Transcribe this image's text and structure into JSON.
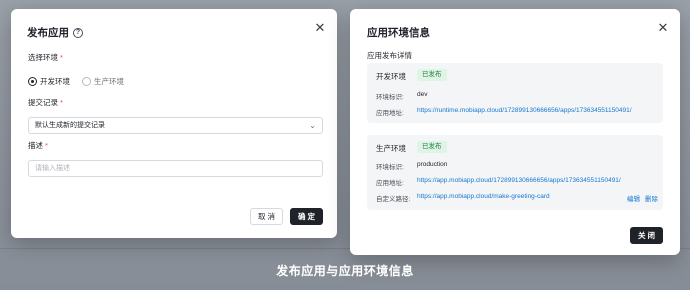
{
  "publish_dialog": {
    "title": "发布应用",
    "help_glyph": "?",
    "close_glyph": "✕",
    "env_label": "选择环境",
    "env_options": [
      "开发环境",
      "生产环境"
    ],
    "env_selected": "开发环境",
    "commit_label": "提交记录",
    "commit_value": "默认生成新的提交记录",
    "desc_label": "描述",
    "desc_placeholder": "请输入描述",
    "cancel_label": "取 消",
    "confirm_label": "确 定",
    "required_mark": "*",
    "chevron_glyph": "⌄"
  },
  "env_info_dialog": {
    "title": "应用环境信息",
    "close_glyph": "✕",
    "section_title": "应用发布详情",
    "envs": [
      {
        "name": "开发环境",
        "status": "已发布",
        "id_label": "环境标识:",
        "id_value": "dev",
        "url_label": "应用地址:",
        "url": "https://runtime.mobiapp.cloud/172899130666656/apps/173634551150491/"
      },
      {
        "name": "生产环境",
        "status": "已发布",
        "id_label": "环境标识:",
        "id_value": "production",
        "url_label": "应用地址:",
        "url": "https://app.mobiapp.cloud/172899130666656/apps/173634551150491/",
        "custom_label": "自定义路径:",
        "custom_url": "https://app.mobiapp.cloud/make-greeting-card",
        "edit_label": "编辑",
        "delete_label": "删除"
      }
    ],
    "close_button_label": "关 闭"
  },
  "caption": "发布应用与应用环境信息",
  "colors": {
    "accent_dark": "#1f2329",
    "link": "#1677d2",
    "badge_bg": "#dff3e6",
    "badge_text": "#1a7f3c",
    "required": "#e5484d"
  }
}
